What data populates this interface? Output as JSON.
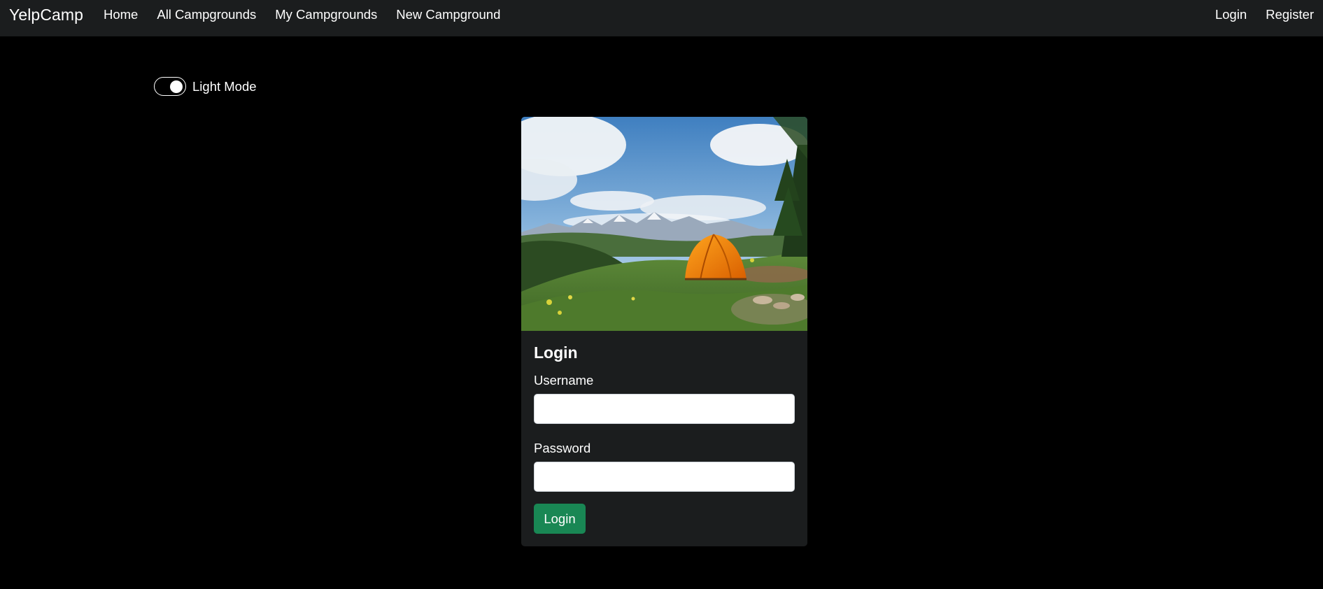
{
  "navbar": {
    "brand": "YelpCamp",
    "links_left": [
      "Home",
      "All Campgrounds",
      "My Campgrounds",
      "New Campground"
    ],
    "links_right": [
      "Login",
      "Register"
    ]
  },
  "theme_toggle": {
    "label": "Light Mode",
    "checked": true
  },
  "login_card": {
    "image_icon": "camping-tent-landscape-image",
    "title": "Login",
    "username_label": "Username",
    "username_value": "",
    "password_label": "Password",
    "password_value": "",
    "submit_label": "Login"
  },
  "colors": {
    "page_background": "#000000",
    "navbar_background": "#1b1d1e",
    "card_background": "#1b1d1e",
    "button_success": "#198754"
  }
}
